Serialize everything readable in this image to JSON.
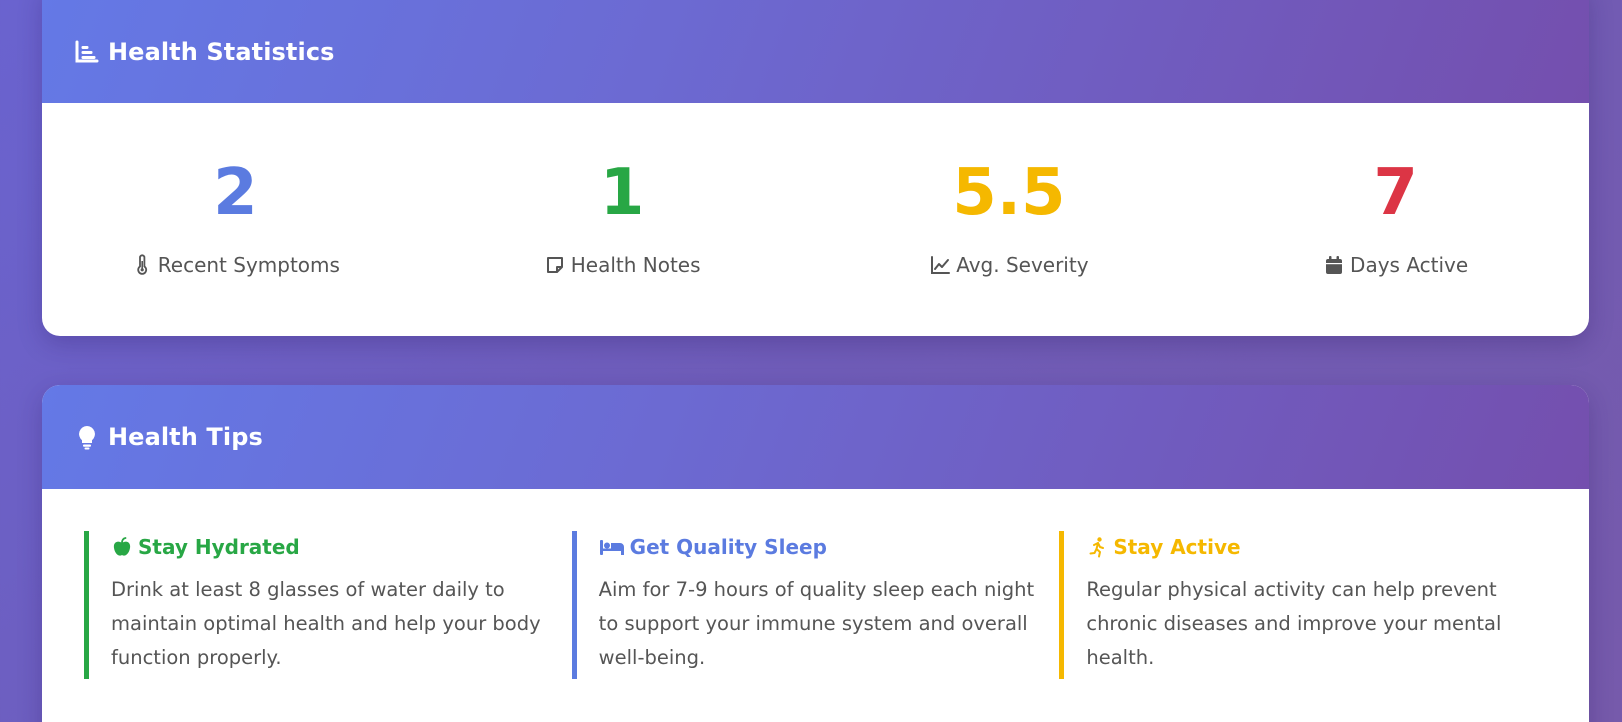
{
  "stats_card": {
    "title": "Health Statistics",
    "icon": "chart-bar-icon",
    "items": [
      {
        "value": "2",
        "label": "Recent Symptoms",
        "icon": "thermometer-icon",
        "color": "#5b7be0"
      },
      {
        "value": "1",
        "label": "Health Notes",
        "icon": "sticky-note-icon",
        "color": "#28a745"
      },
      {
        "value": "5.5",
        "label": "Avg. Severity",
        "icon": "chart-line-icon",
        "color": "#f5b800"
      },
      {
        "value": "7",
        "label": "Days Active",
        "icon": "calendar-icon",
        "color": "#dc3545"
      }
    ]
  },
  "tips_card": {
    "title": "Health Tips",
    "icon": "lightbulb-icon",
    "items": [
      {
        "title": "Stay Hydrated",
        "icon": "apple-icon",
        "color": "#28a745",
        "text": "Drink at least 8 glasses of water daily to maintain optimal health and help your body function properly."
      },
      {
        "title": "Get Quality Sleep",
        "icon": "bed-icon",
        "color": "#5b7be0",
        "text": "Aim for 7-9 hours of quality sleep each night to support your immune system and overall well-being."
      },
      {
        "title": "Stay Active",
        "icon": "running-icon",
        "color": "#f5b800",
        "text": "Regular physical activity can help prevent chronic diseases and improve your mental health."
      }
    ]
  }
}
